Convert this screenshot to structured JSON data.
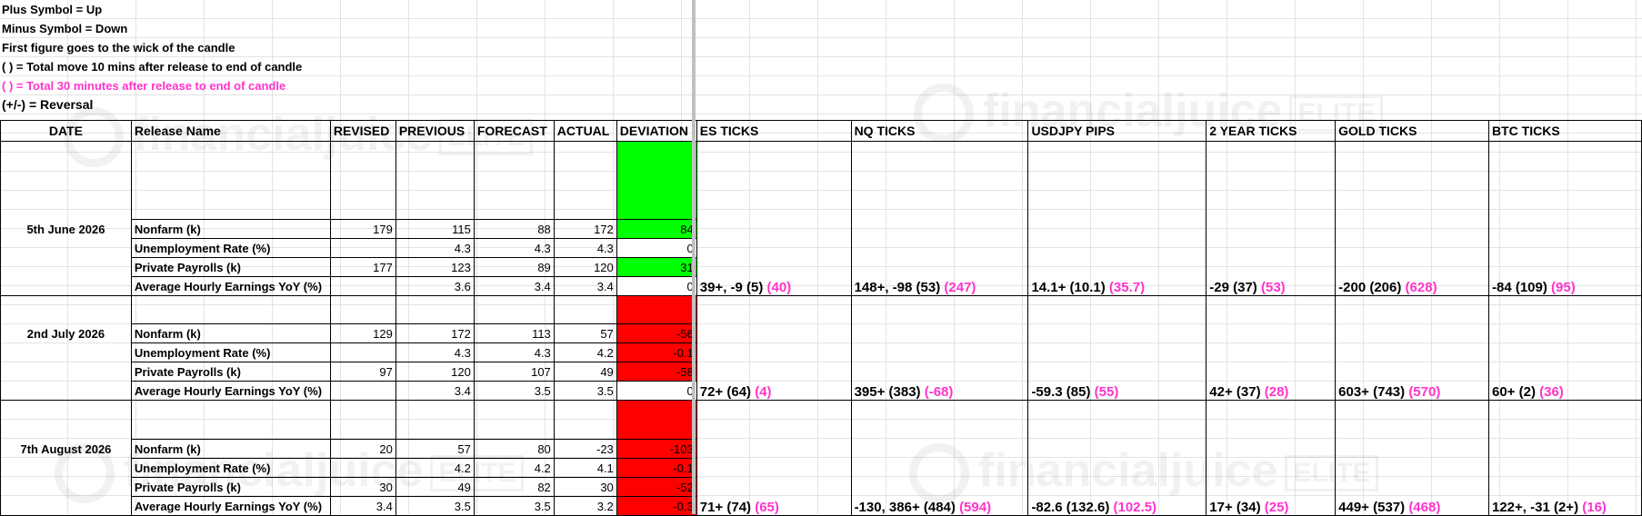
{
  "notes": {
    "line1": "Plus Symbol = Up",
    "line2": "Minus Symbol = Down",
    "line3": "First figure goes to the wick of the candle",
    "line4": "( ) = Total move 10 mins after release to end of candle",
    "line5": "( ) = Total 30 minutes after release to end of candle",
    "line6": "(+/-) = Reversal"
  },
  "watermark": {
    "text": "financialjuice",
    "tag": "ELITE"
  },
  "headers": {
    "date": "DATE",
    "release": "Release Name",
    "revised": "REVISED",
    "previous": "PREVIOUS",
    "forecast": "FORECAST",
    "actual": "ACTUAL",
    "deviation": "DEVIATION",
    "es": "ES TICKS",
    "nq": "NQ TICKS",
    "usdjpy": "USDJPY PIPS",
    "two_year": "2 YEAR TICKS",
    "gold": "GOLD TICKS",
    "btc": "BTC TICKS"
  },
  "colors": {
    "positive": "#00ff00",
    "negative": "#ff0000",
    "thirty_min": "#ff33cc"
  },
  "events": [
    {
      "date": "5th June 2026",
      "rows": [
        {
          "name": "Nonfarm (k)",
          "revised": "179",
          "previous": "115",
          "forecast": "88",
          "actual": "172",
          "deviation": "84"
        },
        {
          "name": "Unemployment Rate (%)",
          "revised": "",
          "previous": "4.3",
          "forecast": "4.3",
          "actual": "4.3",
          "deviation": "0"
        },
        {
          "name": "Private Payrolls (k)",
          "revised": "177",
          "previous": "123",
          "forecast": "89",
          "actual": "120",
          "deviation": "31"
        },
        {
          "name": "Average Hourly Earnings YoY (%)",
          "revised": "",
          "previous": "3.6",
          "forecast": "3.4",
          "actual": "3.4",
          "deviation": "0"
        }
      ],
      "moves": {
        "es": {
          "main": "39+, -9 (5)",
          "p30": "(40)"
        },
        "nq": {
          "main": "148+, -98 (53)",
          "p30": "(247)"
        },
        "usdjpy": {
          "main": "14.1+ (10.1)",
          "p30": "(35.7)"
        },
        "two_year": {
          "main": "-29 (37)",
          "p30": "(53)"
        },
        "gold": {
          "main": "-200 (206)",
          "p30": "(628)"
        },
        "btc": {
          "main": "-84 (109)",
          "p30": "(95)"
        }
      }
    },
    {
      "date": "2nd July 2026",
      "rows": [
        {
          "name": "Nonfarm (k)",
          "revised": "129",
          "previous": "172",
          "forecast": "113",
          "actual": "57",
          "deviation": "-56"
        },
        {
          "name": "Unemployment Rate (%)",
          "revised": "",
          "previous": "4.3",
          "forecast": "4.3",
          "actual": "4.2",
          "deviation": "-0.1"
        },
        {
          "name": "Private Payrolls (k)",
          "revised": "97",
          "previous": "120",
          "forecast": "107",
          "actual": "49",
          "deviation": "-58"
        },
        {
          "name": "Average Hourly Earnings YoY (%)",
          "revised": "",
          "previous": "3.4",
          "forecast": "3.5",
          "actual": "3.5",
          "deviation": "0"
        }
      ],
      "moves": {
        "es": {
          "main": "72+ (64)",
          "p30": "(4)"
        },
        "nq": {
          "main": "395+ (383)",
          "p30": "(-68)"
        },
        "usdjpy": {
          "main": "-59.3 (85)",
          "p30": "(55)"
        },
        "two_year": {
          "main": "42+ (37)",
          "p30": "(28)"
        },
        "gold": {
          "main": "603+ (743)",
          "p30": "(570)"
        },
        "btc": {
          "main": "60+ (2)",
          "p30": "(36)"
        }
      }
    },
    {
      "date": "7th August 2026",
      "rows": [
        {
          "name": "Nonfarm (k)",
          "revised": "20",
          "previous": "57",
          "forecast": "80",
          "actual": "-23",
          "deviation": "-103"
        },
        {
          "name": "Unemployment Rate (%)",
          "revised": "",
          "previous": "4.2",
          "forecast": "4.2",
          "actual": "4.1",
          "deviation": "-0.1"
        },
        {
          "name": "Private Payrolls (k)",
          "revised": "30",
          "previous": "49",
          "forecast": "82",
          "actual": "30",
          "deviation": "-52"
        },
        {
          "name": "Average Hourly Earnings YoY (%)",
          "revised": "3.4",
          "previous": "3.5",
          "forecast": "3.5",
          "actual": "3.2",
          "deviation": "-0.3"
        }
      ],
      "moves": {
        "es": {
          "main": "71+ (74)",
          "p30": "(65)"
        },
        "nq": {
          "main": "-130, 386+ (484)",
          "p30": "(594)"
        },
        "usdjpy": {
          "main": "-82.6 (132.6)",
          "p30": "(102.5)"
        },
        "two_year": {
          "main": "17+ (34)",
          "p30": "(25)"
        },
        "gold": {
          "main": "449+ (537)",
          "p30": "(468)"
        },
        "btc": {
          "main": "122+, -31 (2+)",
          "p30": "(16)"
        }
      }
    }
  ]
}
